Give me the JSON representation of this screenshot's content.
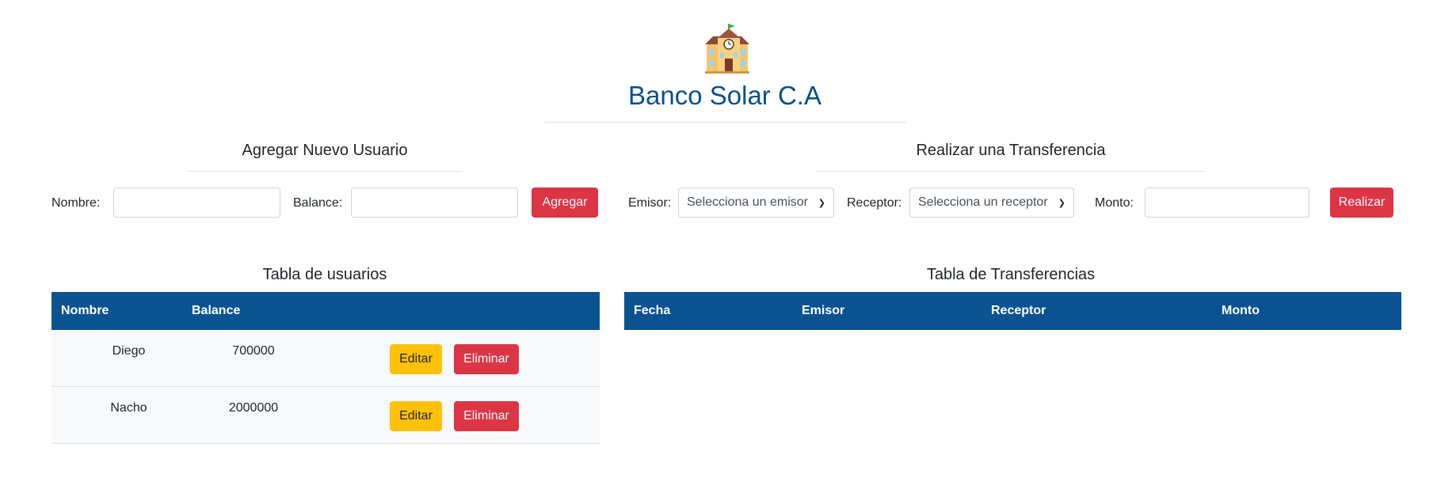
{
  "header": {
    "logo_icon": "school-building-icon",
    "title": "Banco Solar C.A"
  },
  "add_user": {
    "title": "Agregar Nuevo Usuario",
    "nombre_label": "Nombre:",
    "nombre_value": "",
    "balance_label": "Balance:",
    "balance_value": "",
    "submit_label": "Agregar"
  },
  "transfer": {
    "title": "Realizar una Transferencia",
    "emisor_label": "Emisor:",
    "emisor_selected": "Selecciona un emisor",
    "receptor_label": "Receptor:",
    "receptor_selected": "Selecciona un receptor",
    "monto_label": "Monto:",
    "monto_value": "",
    "submit_label": "Realizar"
  },
  "users_table": {
    "title": "Tabla de usuarios",
    "headers": [
      "Nombre",
      "Balance"
    ],
    "rows": [
      {
        "nombre": "Diego",
        "balance": "700000",
        "edit_label": "Editar",
        "delete_label": "Eliminar"
      },
      {
        "nombre": "Nacho",
        "balance": "2000000",
        "edit_label": "Editar",
        "delete_label": "Eliminar"
      }
    ]
  },
  "transfers_table": {
    "title": "Tabla de Transferencias",
    "headers": [
      "Fecha",
      "Emisor",
      "Receptor",
      "Monto"
    ],
    "rows": []
  },
  "colors": {
    "title": "#0b4f8a",
    "table_header": "#0b5390",
    "danger": "#dc3545",
    "warning": "#ffc107"
  }
}
